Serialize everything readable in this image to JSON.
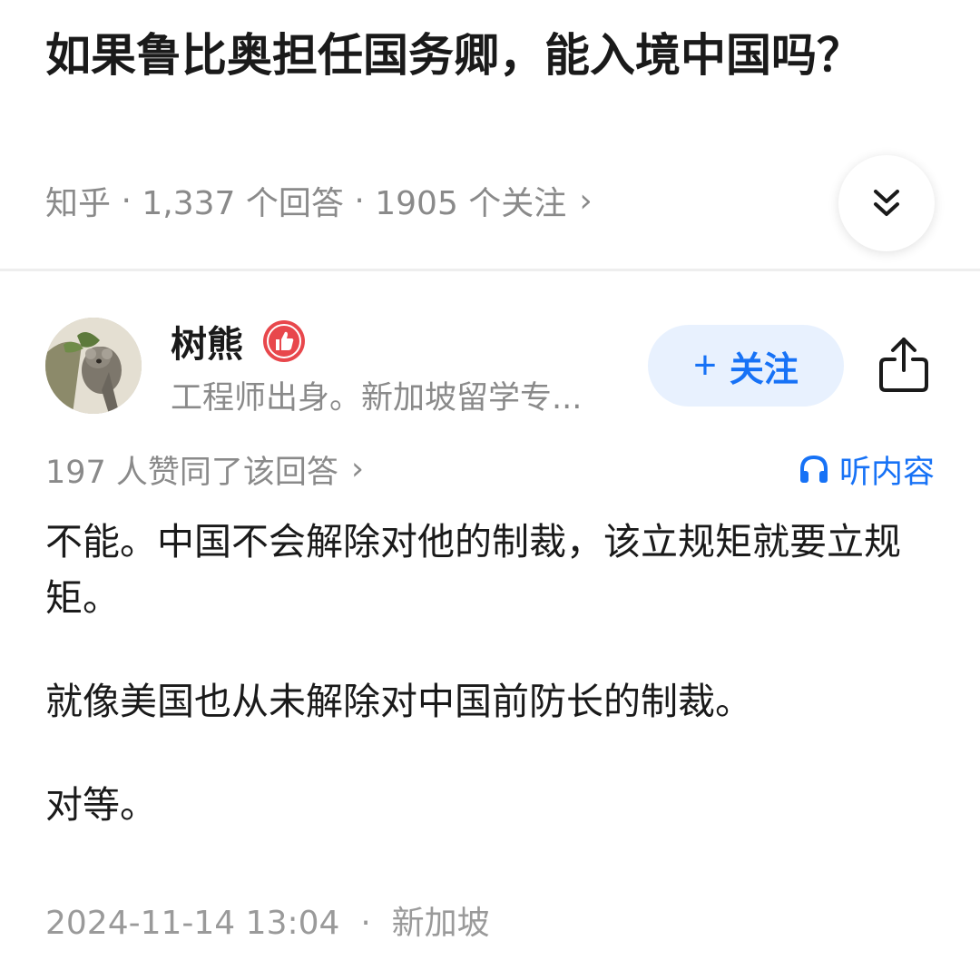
{
  "question": {
    "title": "如果鲁比奥担任国务卿，能入境中国吗？",
    "source": "知乎",
    "answers_count": "1,337 个回答",
    "followers_count": "1905 个关注",
    "separator": "·",
    "chevron": "›"
  },
  "author": {
    "name": "树熊",
    "bio": "工程师出身。新加坡留学专...",
    "follow_label": "关注",
    "follow_plus": "+"
  },
  "answer": {
    "upvote_text": "197 人赞同了该回答",
    "listen_label": "听内容",
    "paragraphs": [
      "不能。中国不会解除对他的制裁，该立规矩就要立规矩。",
      "就像美国也从未解除对中国前防长的制裁。",
      "对等。"
    ],
    "timestamp": "2024-11-14 13:04",
    "location": "新加坡"
  },
  "colors": {
    "accent": "#1772f6",
    "follow_bg": "#e8f1fe",
    "meta_gray": "#8a8a8a",
    "badge_red": "#e8474c"
  },
  "icons": {
    "collapse": "double-chevron-down-icon",
    "badge": "thumbs-up-badge-icon",
    "share": "share-icon",
    "listen": "headphones-icon"
  }
}
